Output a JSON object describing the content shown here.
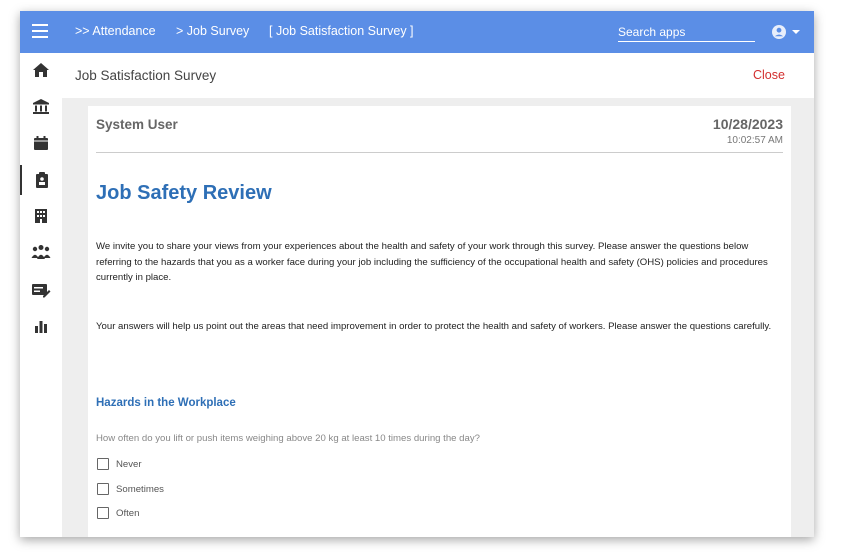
{
  "topbar": {
    "breadcrumbs": [
      ">> Attendance",
      "> Job Survey",
      "[ Job Satisfaction Survey ]"
    ],
    "search_placeholder": "Search apps"
  },
  "sidebar": {
    "items": [
      {
        "icon": "home-icon",
        "active": false
      },
      {
        "icon": "bank-icon",
        "active": false
      },
      {
        "icon": "calendar-icon",
        "active": false
      },
      {
        "icon": "clipboard-badge-icon",
        "active": true
      },
      {
        "icon": "building-icon",
        "active": false
      },
      {
        "icon": "people-icon",
        "active": false
      },
      {
        "icon": "edit-note-icon",
        "active": false
      },
      {
        "icon": "bar-chart-icon",
        "active": false
      }
    ]
  },
  "header": {
    "title": "Job Satisfaction Survey",
    "close_label": "Close"
  },
  "card": {
    "user_name": "System User",
    "date": "10/28/2023",
    "time": "10:02:57 AM",
    "survey_title": "Job Safety Review",
    "intro_paragraph_1": "We invite you to share your views from your experiences about the health and safety of your work through this survey. Please answer the questions below referring to the hazards that you as a worker face during your job including the sufficiency of the occupational health and safety (OHS) policies and procedures currently in place.",
    "intro_paragraph_2": "Your answers will help us point out the areas that need improvement in order to protect the health and safety of workers. Please answer the questions carefully.",
    "section_title": "Hazards in the Workplace",
    "question_1": "How often do you lift or push items weighing above 20 kg at least 10 times during the day?",
    "options": [
      "Never",
      "Sometimes",
      "Often"
    ]
  },
  "colors": {
    "topbar": "#5b8ee6",
    "accent_title": "#2e6fb6",
    "close": "#d32f2f"
  }
}
